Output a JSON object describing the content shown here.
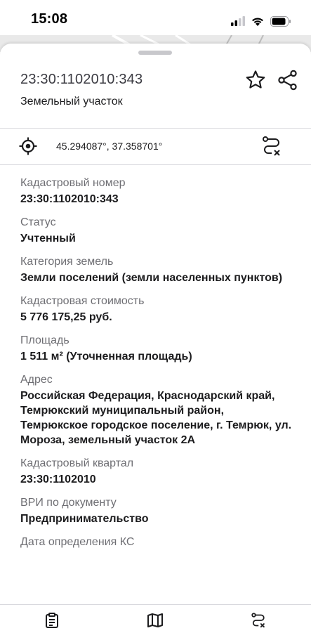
{
  "status_bar": {
    "time": "15:08"
  },
  "header": {
    "title": "23:30:1102010:343",
    "subtitle": "Земельный участок"
  },
  "coordinates": {
    "text": "45.294087°, 37.358701°"
  },
  "fields": [
    {
      "label": "Кадастровый номер",
      "value": "23:30:1102010:343"
    },
    {
      "label": "Статус",
      "value": "Учтенный"
    },
    {
      "label": "Категория земель",
      "value": "Земли поселений (земли населенных пунктов)"
    },
    {
      "label": "Кадастровая стоимость",
      "value": "5 776 175,25 руб."
    },
    {
      "label": "Площадь",
      "value": "1 511 м² (Уточненная площадь)"
    },
    {
      "label": "Адрес",
      "value": "Российская Федерация, Краснодарский край, Темрюкский муниципальный район, Темрюкское городское поселение, г. Темрюк, ул. Мороза, земельный участок 2А"
    },
    {
      "label": "Кадастровый квартал",
      "value": "23:30:1102010"
    },
    {
      "label": "ВРИ по документу",
      "value": "Предпринимательство"
    },
    {
      "label": "Дата определения КС",
      "value": ""
    }
  ],
  "icons": {
    "favorite": "star-icon",
    "share": "share-icon",
    "locate": "crosshair-icon",
    "route": "route-cancel-icon",
    "tab_info": "clipboard-icon",
    "tab_map": "map-icon",
    "tab_route": "route-cancel-icon"
  },
  "colors": {
    "text": "#1c1c1e",
    "label": "#6e6e73",
    "divider": "#d9d9de"
  }
}
